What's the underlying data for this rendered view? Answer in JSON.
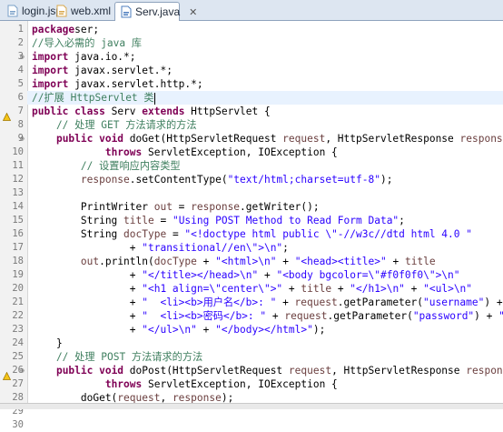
{
  "tabs": [
    {
      "label": "login.jsp",
      "icon": "jsp-file-icon",
      "active": false
    },
    {
      "label": "web.xml",
      "icon": "xml-file-icon",
      "active": false
    },
    {
      "label": "Serv.java",
      "icon": "java-file-icon",
      "active": true
    }
  ],
  "close_glyph": "✕",
  "code_lines": [
    {
      "n": "1",
      "segs": [
        [
          "kw",
          "package"
        ],
        [
          "",
          "ser;"
        ]
      ]
    },
    {
      "n": "2",
      "segs": [
        [
          "cm",
          "//导入必需的 java 库"
        ]
      ]
    },
    {
      "n": "3",
      "fold": "⊖",
      "segs": [
        [
          "kw",
          "import"
        ],
        [
          "",
          " java.io.*;"
        ]
      ]
    },
    {
      "n": "4",
      "segs": [
        [
          "kw",
          "import"
        ],
        [
          "",
          " javax.servlet.*;"
        ]
      ]
    },
    {
      "n": "5",
      "segs": [
        [
          "kw",
          "import"
        ],
        [
          "",
          " javax.servlet.http.*;"
        ]
      ]
    },
    {
      "n": "6",
      "current": true,
      "segs": [
        [
          "cm",
          "//扩展 HttpServlet 类"
        ]
      ]
    },
    {
      "n": "7",
      "warn": true,
      "segs": [
        [
          "kw",
          "public class"
        ],
        [
          "",
          " "
        ],
        [
          "",
          "Serv"
        ],
        [
          "",
          " "
        ],
        [
          "kw",
          "extends"
        ],
        [
          "",
          " HttpServlet {"
        ]
      ]
    },
    {
      "n": "8",
      "segs": [
        [
          "cm",
          "    // 处理 GET 方法请求的方法"
        ]
      ]
    },
    {
      "n": "9",
      "fold": "⊖",
      "segs": [
        [
          "",
          "    "
        ],
        [
          "kw",
          "public void"
        ],
        [
          "",
          " doGet(HttpServletRequest "
        ],
        [
          "param",
          "request"
        ],
        [
          "",
          ", HttpServletResponse "
        ],
        [
          "param",
          "response"
        ],
        [
          "",
          ")"
        ]
      ]
    },
    {
      "n": "10",
      "segs": [
        [
          "",
          "            "
        ],
        [
          "kw",
          "throws"
        ],
        [
          "",
          " ServletException, IOException {"
        ]
      ]
    },
    {
      "n": "11",
      "segs": [
        [
          "cm",
          "        // 设置响应内容类型"
        ]
      ]
    },
    {
      "n": "12",
      "segs": [
        [
          "",
          "        "
        ],
        [
          "param",
          "response"
        ],
        [
          "",
          ".setContentType("
        ],
        [
          "str",
          "\"text/html;charset=utf-8\""
        ],
        [
          "",
          ");"
        ]
      ]
    },
    {
      "n": "13",
      "segs": [
        [
          "",
          ""
        ]
      ]
    },
    {
      "n": "14",
      "segs": [
        [
          "",
          "        PrintWriter "
        ],
        [
          "param",
          "out"
        ],
        [
          "",
          " = "
        ],
        [
          "param",
          "response"
        ],
        [
          "",
          ".getWriter();"
        ]
      ]
    },
    {
      "n": "15",
      "segs": [
        [
          "",
          "        String "
        ],
        [
          "param",
          "title"
        ],
        [
          "",
          " = "
        ],
        [
          "str",
          "\"Using POST Method to Read Form Data\""
        ],
        [
          "",
          ";"
        ]
      ]
    },
    {
      "n": "16",
      "segs": [
        [
          "",
          "        String "
        ],
        [
          "param",
          "docType"
        ],
        [
          "",
          " = "
        ],
        [
          "str",
          "\"<!doctype html public \\\"-//w3c//dtd html 4.0 \""
        ]
      ]
    },
    {
      "n": "17",
      "segs": [
        [
          "",
          "                + "
        ],
        [
          "str",
          "\"transitional//en\\\">\\n\""
        ],
        [
          "",
          ";"
        ]
      ]
    },
    {
      "n": "18",
      "segs": [
        [
          "",
          "        "
        ],
        [
          "param",
          "out"
        ],
        [
          "",
          ".println("
        ],
        [
          "param",
          "docType"
        ],
        [
          "",
          " + "
        ],
        [
          "str",
          "\"<html>\\n\""
        ],
        [
          "",
          " + "
        ],
        [
          "str",
          "\"<head><title>\""
        ],
        [
          "",
          " + "
        ],
        [
          "param",
          "title"
        ]
      ]
    },
    {
      "n": "19",
      "segs": [
        [
          "",
          "                + "
        ],
        [
          "str",
          "\"</title></head>\\n\""
        ],
        [
          "",
          " + "
        ],
        [
          "str",
          "\"<body bgcolor=\\\"#f0f0f0\\\">\\n\""
        ]
      ]
    },
    {
      "n": "20",
      "segs": [
        [
          "",
          "                + "
        ],
        [
          "str",
          "\"<h1 align=\\\"center\\\">\""
        ],
        [
          "",
          " + "
        ],
        [
          "param",
          "title"
        ],
        [
          "",
          " + "
        ],
        [
          "str",
          "\"</h1>\\n\""
        ],
        [
          "",
          " + "
        ],
        [
          "str",
          "\"<ul>\\n\""
        ]
      ]
    },
    {
      "n": "21",
      "segs": [
        [
          "",
          "                + "
        ],
        [
          "str",
          "\"  <li><b>用户名</b>: \""
        ],
        [
          "",
          " + "
        ],
        [
          "param",
          "request"
        ],
        [
          "",
          ".getParameter("
        ],
        [
          "str",
          "\"username\""
        ],
        [
          "",
          ") + "
        ],
        [
          "str",
          "\"\\n\""
        ]
      ]
    },
    {
      "n": "22",
      "segs": [
        [
          "",
          "                + "
        ],
        [
          "str",
          "\"  <li><b>密码</b>: \""
        ],
        [
          "",
          " + "
        ],
        [
          "param",
          "request"
        ],
        [
          "",
          ".getParameter("
        ],
        [
          "str",
          "\"password\""
        ],
        [
          "",
          ") + "
        ],
        [
          "str",
          "\"\\n\""
        ]
      ]
    },
    {
      "n": "23",
      "segs": [
        [
          "",
          "                + "
        ],
        [
          "str",
          "\"</ul>\\n\""
        ],
        [
          "",
          " + "
        ],
        [
          "str",
          "\"</body></html>\""
        ],
        [
          "",
          ");"
        ]
      ]
    },
    {
      "n": "24",
      "segs": [
        [
          "",
          "    }"
        ]
      ]
    },
    {
      "n": "25",
      "segs": [
        [
          "cm",
          "    // 处理 POST 方法请求的方法"
        ]
      ]
    },
    {
      "n": "26",
      "fold": "⊖",
      "warn": true,
      "segs": [
        [
          "",
          "    "
        ],
        [
          "kw",
          "public void"
        ],
        [
          "",
          " doPost(HttpServletRequest "
        ],
        [
          "param",
          "request"
        ],
        [
          "",
          ", HttpServletResponse "
        ],
        [
          "param",
          "response"
        ],
        [
          "",
          ")"
        ]
      ]
    },
    {
      "n": "27",
      "segs": [
        [
          "",
          "            "
        ],
        [
          "kw",
          "throws"
        ],
        [
          "",
          " ServletException, IOException {"
        ]
      ]
    },
    {
      "n": "28",
      "segs": [
        [
          "",
          "        doGet("
        ],
        [
          "param",
          "request"
        ],
        [
          "",
          ", "
        ],
        [
          "param",
          "response"
        ],
        [
          "",
          ");"
        ]
      ]
    },
    {
      "n": "29",
      "segs": [
        [
          "",
          "    }"
        ]
      ]
    },
    {
      "n": "30",
      "segs": [
        [
          "",
          ""
        ]
      ]
    }
  ],
  "colors": {
    "keyword": "#7f0055",
    "string": "#2a00ff",
    "comment": "#3f7f5f",
    "param": "#6a3e3e"
  }
}
